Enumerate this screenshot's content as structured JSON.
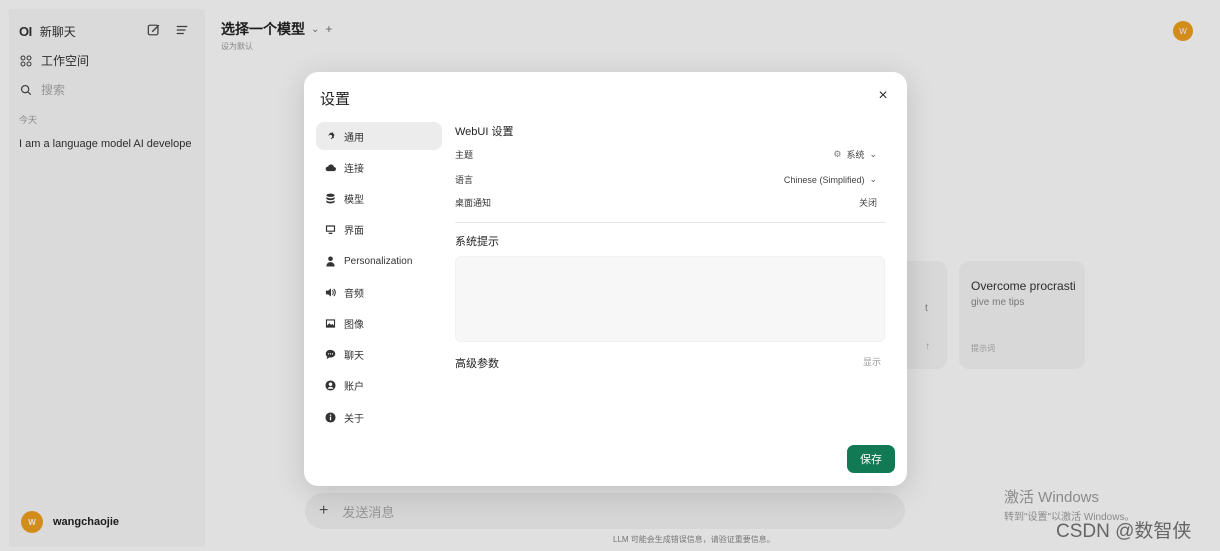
{
  "sidebar": {
    "logo": "OI",
    "new_chat": "新聊天",
    "workspace": "工作空间",
    "search_placeholder": "搜索",
    "today_label": "今天",
    "chat_items": [
      "I am a language model AI develope"
    ],
    "user_name": "wangchaojie",
    "avatar_letter": "W"
  },
  "header": {
    "model_select": "选择一个模型",
    "set_default": "设为默认",
    "plus": "+",
    "avatar_letter": "W"
  },
  "suggestions": [
    {
      "title": "",
      "subtitle": "t",
      "footer": "↑"
    },
    {
      "title": "Overcome procrasti",
      "subtitle": "give me tips",
      "footer": "提示词"
    }
  ],
  "input": {
    "plus": "+",
    "placeholder": "发送消息"
  },
  "disclaimer": "LLM 可能会生成错误信息，请验证重要信息。",
  "watermark": {
    "title": "激活 Windows",
    "subtitle": "转到\"设置\"以激活 Windows。",
    "csdn": "CSDN @数智侠"
  },
  "modal": {
    "title": "设置",
    "close": "×",
    "tabs": [
      {
        "label": "通用",
        "icon": "gear-icon",
        "active": true
      },
      {
        "label": "连接",
        "icon": "cloud-icon"
      },
      {
        "label": "模型",
        "icon": "database-icon"
      },
      {
        "label": "界面",
        "icon": "monitor-icon"
      },
      {
        "label": "Personalization",
        "icon": "person-icon"
      },
      {
        "label": "音频",
        "icon": "speaker-icon"
      },
      {
        "label": "图像",
        "icon": "image-icon"
      },
      {
        "label": "聊天",
        "icon": "chat-bubble-icon"
      },
      {
        "label": "账户",
        "icon": "user-circle-icon"
      },
      {
        "label": "关于",
        "icon": "info-icon"
      }
    ],
    "general": {
      "section_title": "WebUI 设置",
      "theme_label": "主题",
      "theme_value": "系统",
      "language_label": "语言",
      "language_value": "Chinese (Simplified)",
      "notify_label": "桌面通知",
      "notify_value": "关闭",
      "system_prompt_title": "系统提示",
      "system_prompt_value": "",
      "advanced_title": "高级参数",
      "advanced_toggle": "显示"
    },
    "save_label": "保存",
    "colors": {
      "save": "#117a55",
      "avatar": "#f0a020"
    }
  }
}
